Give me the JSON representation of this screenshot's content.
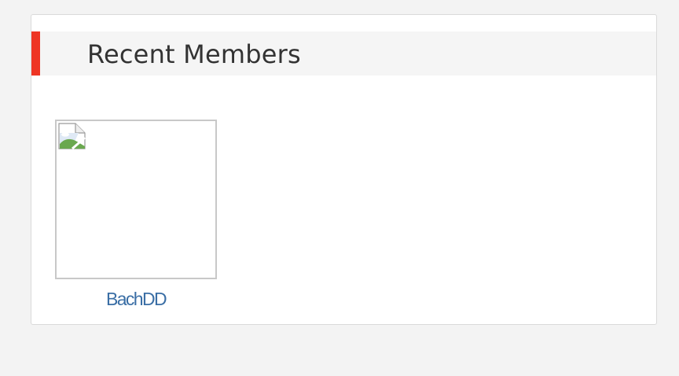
{
  "widget": {
    "title": "Recent Members",
    "accent_color": "#ee3524"
  },
  "members": [
    {
      "name": "BachDD",
      "avatar_icon": "broken-image-icon"
    }
  ]
}
